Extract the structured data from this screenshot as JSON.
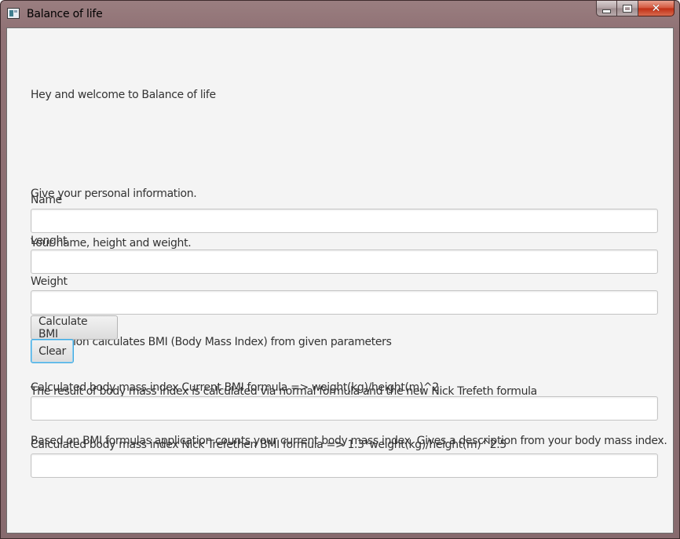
{
  "window": {
    "title": "Balance of life",
    "controls": [
      "minimize-icon",
      "maximize-icon",
      "close-icon"
    ]
  },
  "intro": {
    "lines": [
      "Hey and welcome to Balance of life",
      "",
      "Give your personal information.",
      "Your name, height and weight.",
      "",
      "Application calculates BMI (Body Mass Index) from given parameters",
      "The result of body mass index is calculated via normal formula and the new Nick Trefeth formula",
      "Based on BMI formulas application counts your current body mass index. Gives a description from your body mass index."
    ]
  },
  "form": {
    "name_label": "Name",
    "name_value": "",
    "length_label": "Lenght",
    "length_value": "",
    "weight_label": "Weight",
    "weight_value": "",
    "calculate_label": "Calculate BMI",
    "clear_label": "Clear"
  },
  "results": {
    "current_label": "Calculated body mass index Current BMI formula => weight(kg)/height(m)^2",
    "current_value": "",
    "trefethen_label": "Calculated body mass index Nick Trefethen BMI formula => 1.3*weight(kg)/height(m)^2.5",
    "trefethen_value": ""
  },
  "colors": {
    "focus_border": "#3ea8e0",
    "background": "#f4f4f4",
    "text": "#333333"
  }
}
